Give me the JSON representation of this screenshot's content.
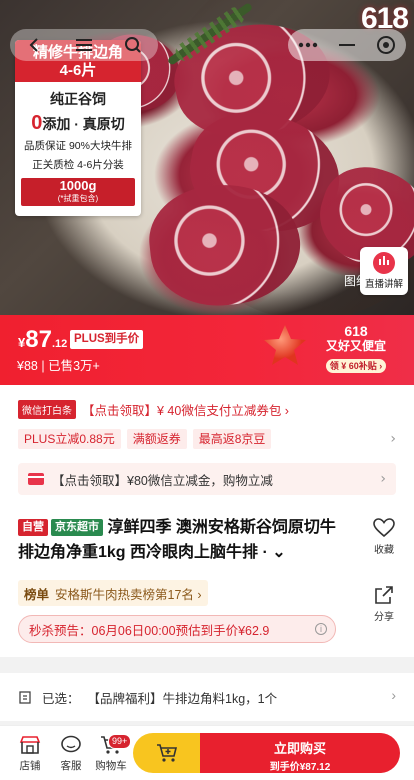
{
  "hero": {
    "badge_618": "618",
    "side_tag": "图组",
    "live_button_label": "直播讲解",
    "card": {
      "line1": "精修牛排边角",
      "line2": "4-6片",
      "feature1": "纯正谷饲",
      "feature2_big": "0",
      "feature2_rest": "添加 · 真原切",
      "feature3": "品质保证 90%大块牛排",
      "feature4": "正关质检 4-6片分装",
      "weight": "1000g",
      "weight_note": "(*拭重包含)"
    }
  },
  "nav": {
    "back_icon": "back-arrow-icon",
    "menu_icon": "menu-icon",
    "search_icon": "search-icon",
    "more_icon": "more-icon",
    "close_icon": "minimize-icon",
    "target_icon": "target-icon"
  },
  "price": {
    "currency": "¥",
    "integer": "87",
    "decimal": ".12",
    "plus_label": "PLUS到手价",
    "original": "¥88",
    "sold": "已售3万+",
    "promo_a": "618",
    "promo_b": "又好又便宜",
    "promo_c": "领 ¥ 60补贴 ›"
  },
  "promo": {
    "wx_tag": "微信打白条",
    "wx_text": "【点击领取】¥ 40微信支付立减券包 ›",
    "chips": [
      "PLUS立减0.88元",
      "满额返券",
      "最高返8京豆"
    ],
    "bar_text": "【点击领取】¥80微信立减金，购物立减"
  },
  "product": {
    "tag_self": "自营",
    "tag_jd": "京东超市",
    "title": "淳鲜四季 澳洲安格斯谷饲原切牛排边角净重1kg 西冷眼肉上脑牛排 ·",
    "collect_label": "收藏",
    "rank_key": "榜单",
    "rank_value": "安格斯牛肉热卖榜第17名 ›",
    "share_label": "分享",
    "flash_text": "秒杀预告：06月06日00:00预估到手价¥62.9",
    "info_icon": "i"
  },
  "selected": {
    "label": "已选：",
    "value": "【品牌福利】牛排边角料1kg，1个"
  },
  "bottom": {
    "store": "店铺",
    "service": "客服",
    "cart": "购物车",
    "cart_badge": "99+",
    "buy_now": "立即购买",
    "buy_price": "到手价¥87.12"
  },
  "colors": {
    "accent": "#e8202e",
    "yellow": "#f8c51f"
  }
}
